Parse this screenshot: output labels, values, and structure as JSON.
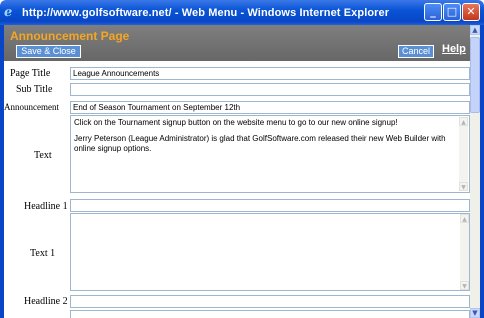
{
  "window": {
    "title": "http://www.golfsoftware.net/ - Web Menu - Windows Internet Explorer",
    "minimize_glyph": "_",
    "maximize_glyph": "□",
    "close_glyph": "✕"
  },
  "header": {
    "title": "Announcement Page",
    "save_close_label": "Save & Close",
    "cancel_label": "Cancel",
    "help_label": "Help"
  },
  "form": {
    "page_title": {
      "label": "Page Title",
      "value": "League Announcements"
    },
    "sub_title": {
      "label": "Sub Title",
      "value": ""
    },
    "announcement": {
      "label": "Announcement",
      "value": "End of Season Tournament on September 12th"
    },
    "text": {
      "label": "Text",
      "paragraph1": "Click on the Tournament signup button on the website menu to go to our new online signup!",
      "paragraph2": "Jerry Peterson (League Administrator) is glad that GolfSoftware.com released their new Web Builder with online signup options."
    },
    "headline1": {
      "label": "Headline 1",
      "value": ""
    },
    "text1": {
      "label": "Text 1",
      "value": ""
    },
    "headline2": {
      "label": "Headline 2",
      "value": ""
    }
  },
  "icons": {
    "browser": "ie-icon",
    "scroll_up": "▲",
    "scroll_down": "▼"
  },
  "colors": {
    "title_bar": "#0a54d6",
    "header_bg": "#737373",
    "header_title": "#f5a623",
    "button_bg": "#5a8fd3"
  }
}
